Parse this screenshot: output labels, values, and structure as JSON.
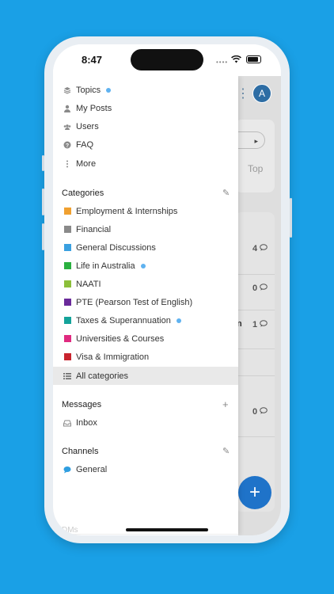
{
  "status": {
    "time": "8:47"
  },
  "background": {
    "avatar_letter": "A",
    "top_label": "Top",
    "pill_arrow": "▸",
    "counts": [
      "4",
      "0",
      "1",
      "0"
    ],
    "cut_label": "n",
    "fab_label": "+"
  },
  "drawer": {
    "nav": [
      {
        "label": "Topics",
        "icon": "layers-icon",
        "unread": true
      },
      {
        "label": "My Posts",
        "icon": "user-icon",
        "unread": false
      },
      {
        "label": "Users",
        "icon": "users-icon",
        "unread": false
      },
      {
        "label": "FAQ",
        "icon": "question-icon",
        "unread": false
      },
      {
        "label": "More",
        "icon": "more-vertical-icon",
        "unread": false
      }
    ],
    "categories_title": "Categories",
    "categories": [
      {
        "label": "Employment & Internships",
        "color": "#f0a030",
        "unread": false
      },
      {
        "label": "Financial",
        "color": "#8a8a8a",
        "unread": false
      },
      {
        "label": "General Discussions",
        "color": "#3aa0e0",
        "unread": false
      },
      {
        "label": "Life in Australia",
        "color": "#2ab040",
        "unread": true
      },
      {
        "label": "NAATI",
        "color": "#8cbf3a",
        "unread": false
      },
      {
        "label": "PTE (Pearson Test of English)",
        "color": "#6a2a9a",
        "unread": false
      },
      {
        "label": "Taxes & Superannuation",
        "color": "#14a39a",
        "unread": true
      },
      {
        "label": "Universities & Courses",
        "color": "#e02a80",
        "unread": false
      },
      {
        "label": "Visa & Immigration",
        "color": "#c8242e",
        "unread": false
      }
    ],
    "all_categories": "All categories",
    "messages_title": "Messages",
    "inbox": "Inbox",
    "channels_title": "Channels",
    "general": "General",
    "dms_title": "DMs",
    "plus": "+",
    "pencil": "✎"
  }
}
